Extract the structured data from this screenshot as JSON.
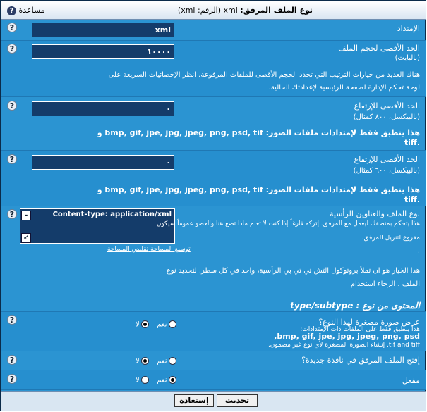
{
  "window": {
    "title_bold": "نوع الملف المرفق:",
    "title_rest": "xml (الرقم: xml)",
    "help_label": "مساعدة"
  },
  "rows": {
    "extension": {
      "label": "الإمتداد",
      "value": "xml"
    },
    "max_size": {
      "label": "الحد الأقصى لحجم الملف",
      "sub": "(بالبايت)",
      "value": "١٠٠٠٠",
      "desc1": "هناك العديد من خيارات الترتيب التي تحدد الحجم الأقصى للملفات المرفوعة. انظر الإحصائيات السريعة على",
      "desc2": "لوحة تحكم الإدارة لصفحة الرئيسية لإعدادتك الحالية."
    },
    "max_width": {
      "label": "الحد الأقصى للإرتفاع",
      "sub": "(بالبيكسل، ٨٠٠ كمثال)",
      "value": "٠",
      "desc1": "هذا ينطبق فقط لإمتدادات ملفات الصور: bmp, gif, jpe, jpg, jpeg, png, psd, tif و",
      "desc2": ".tiff"
    },
    "max_height": {
      "label": "الحد الأقصى للإرتفاع",
      "sub": "(بالبيكسل، ٦٠٠ كمثال)",
      "value": "٠",
      "desc1": "هذا ينطبق فقط لإمتدادات ملفات الصور: bmp, gif, jpe, jpg, jpeg, png, psd, tif و",
      "desc2": ".tiff"
    },
    "mime": {
      "label": "نوع الملف والعناوين الرأسية",
      "value": "Content-type: application/xml",
      "line1": "هذا يتحكم بمنصفك ليعمل مع المرفق. إتركه فارغاً إذا كنت لا تعلم ماذا تضع هنا والعضو عموماً سيكون",
      "line2": "مفروع لتنزيل المرفق.",
      "line3": ".",
      "desc1": "هذا الخيار هو ان تملأ بروتوكول التش تي تي بي الرأسية، واحد في كل سطر. لتحديد نوع",
      "desc2": "الملف ، الرجاء استخدام",
      "expand": "توسيع المساحة",
      "shrink": "تقليص المساحة",
      "section": "المحتوى من نوع : type/subtype"
    },
    "thumbnail": {
      "label": "عرض صورة مصغرة لهذا النوع؟",
      "desc1": "هذا ينطبق فقط على الملفات ذات الإمتدادات:",
      "desc2": "bmp, gif, jpe, jpg, jpeg, png, psd,",
      "desc3": "tif and tiff. إنشاء الصورة المصغرة لأي نوع غير مضمون.",
      "yes": "نعم",
      "no": "لا"
    },
    "newwindow": {
      "label": "إفتح الملف المرفق في نافذة جديدة؟",
      "yes": "نعم",
      "no": "لا"
    },
    "enabled": {
      "label": "مفعل",
      "yes": "نعم",
      "no": "لا"
    }
  },
  "footer": {
    "submit": "تحديث",
    "reset": "إستعادة"
  }
}
